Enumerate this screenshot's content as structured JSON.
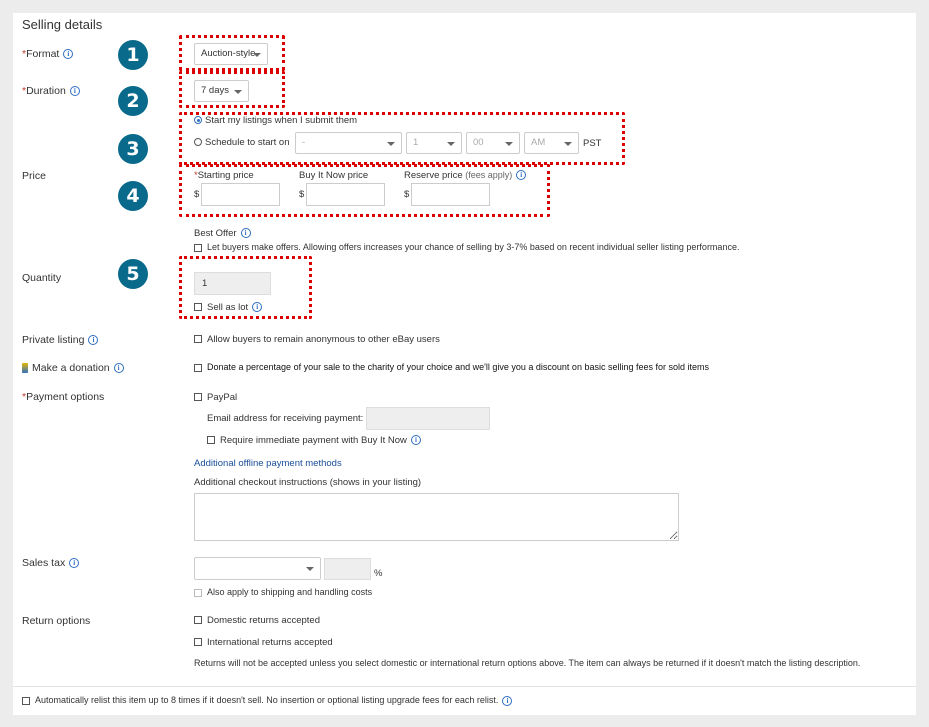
{
  "section_title": "Selling details",
  "format": {
    "label": "Format",
    "req": "*",
    "value": "Auction-style"
  },
  "duration": {
    "label": "Duration",
    "req": "*",
    "value": "7 days"
  },
  "schedule": {
    "option1": "Start my listings when I submit them",
    "option2": "Schedule to start on",
    "date": "-",
    "hour": "1",
    "minute": "00",
    "ampm": "AM",
    "tz": "PST"
  },
  "price": {
    "label": "Price",
    "starting_label": "Starting price",
    "req": "*",
    "buy_now_label": "Buy It Now price",
    "reserve_label": "Reserve price",
    "reserve_note": "(fees apply)",
    "currency": "$"
  },
  "best_offer": {
    "label": "Best Offer",
    "checkbox": "Let buyers make offers. Allowing offers increases your chance of selling by 3-7% based on recent individual seller listing performance."
  },
  "quantity": {
    "label": "Quantity",
    "value": "1",
    "lot": "Sell as lot"
  },
  "private_listing": {
    "label": "Private listing",
    "checkbox": "Allow buyers to remain anonymous to other eBay users"
  },
  "donation": {
    "label": "Make a donation",
    "checkbox": "Donate a percentage of your sale to the charity of your choice and we'll give you a discount on basic selling fees for sold items"
  },
  "payment": {
    "label": "Payment options",
    "req": "*",
    "paypal": "PayPal",
    "email_label": "Email address for receiving payment:",
    "immediate": "Require immediate payment with Buy It Now",
    "offline_link": "Additional offline payment methods",
    "checkout_label": "Additional checkout instructions (shows in your listing)"
  },
  "sales_tax": {
    "label": "Sales tax",
    "percent": "%",
    "apply": "Also apply to shipping and handling costs"
  },
  "returns": {
    "label": "Return options",
    "domestic": "Domestic returns accepted",
    "international": "International returns accepted",
    "note": "Returns will not be accepted unless you select domestic or international return options above. The item can always be returned if it doesn't match the listing description."
  },
  "relist": {
    "checkbox": "Automatically relist this item up to 8 times if it doesn't sell. No insertion or optional listing upgrade fees for each relist."
  },
  "badges": [
    "1",
    "2",
    "3",
    "4",
    "5"
  ],
  "colors": {
    "badge": "#0a6a8c",
    "highlight": "#dd0000",
    "link": "#1a4d9a",
    "required": "#c0392b"
  }
}
